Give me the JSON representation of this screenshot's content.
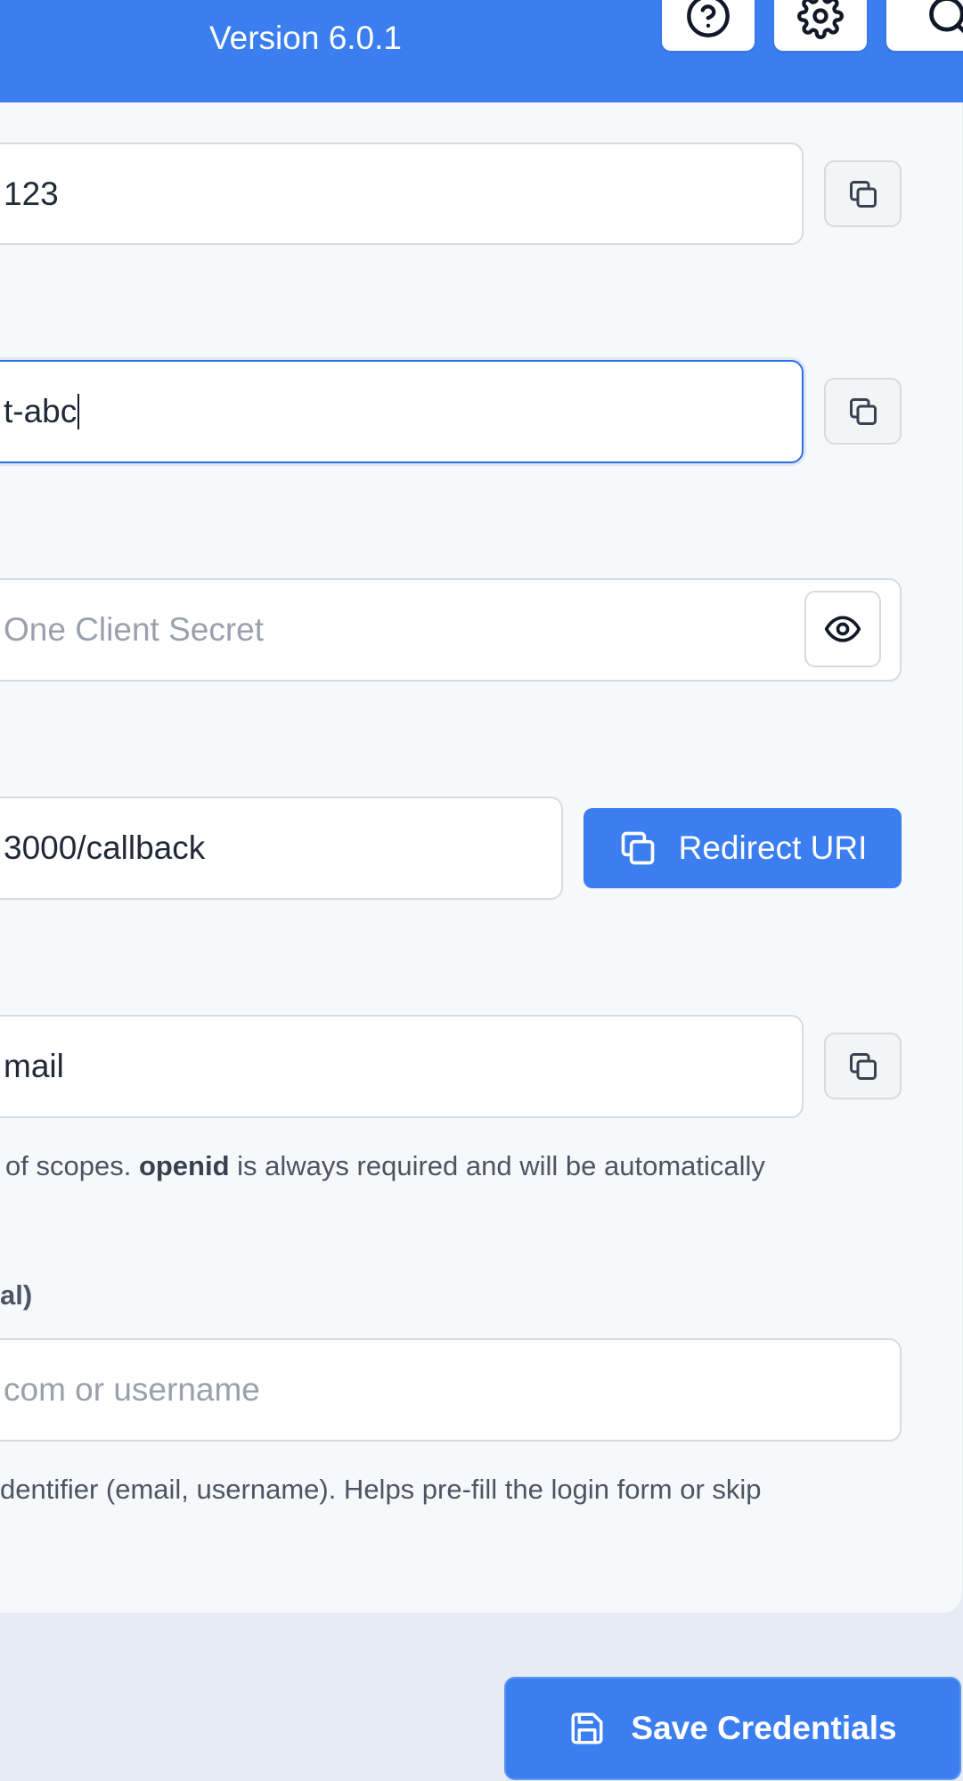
{
  "header": {
    "version": "Version 6.0.1",
    "help_icon": "help-circle-icon",
    "settings_icon": "gear-icon",
    "search_icon": "search-icon"
  },
  "form": {
    "client_id": {
      "value": "123",
      "copy_icon": "copy-icon"
    },
    "client_name": {
      "value": "t-abc",
      "copy_icon": "copy-icon"
    },
    "client_secret": {
      "placeholder": "One Client Secret",
      "toggle_icon": "eye-icon"
    },
    "redirect_uri": {
      "value": "3000/callback",
      "button_label": "Redirect URI",
      "button_icon": "copy-icon"
    },
    "scopes": {
      "value": "mail",
      "copy_icon": "copy-icon",
      "help_prefix": "of scopes.",
      "help_bold": "openid",
      "help_suffix": "is always required and will be automatically"
    },
    "login_hint": {
      "label": "al)",
      "placeholder": "com or username",
      "help": "dentifier (email, username). Helps pre-fill the login form or skip"
    }
  },
  "actions": {
    "save_label": "Save Credentials",
    "save_icon": "save-icon"
  },
  "colors": {
    "primary": "#3b7ef0",
    "focus_border": "#2f6fe6",
    "background": "#e7ebf3",
    "panel": "#f7f8fa"
  }
}
